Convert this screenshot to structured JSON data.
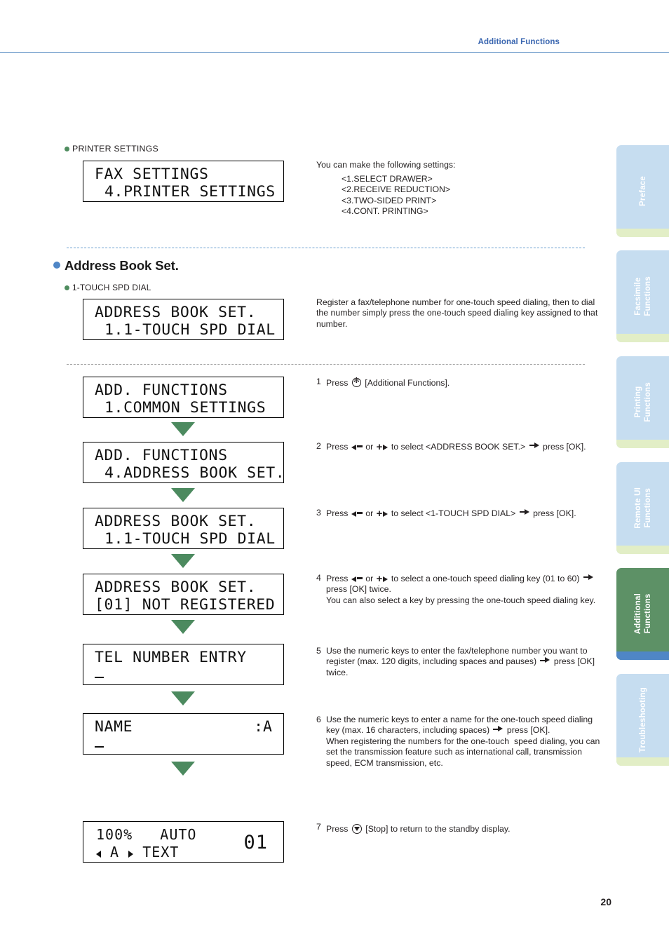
{
  "header": {
    "title": "Additional Functions"
  },
  "page_number": "20",
  "printer_settings": {
    "label": "PRINTER SETTINGS",
    "lcd": {
      "line1": "FAX SETTINGS",
      "line2": "4.PRINTER SETTINGS"
    },
    "intro": "You can make the following settings:",
    "options": [
      "<1.SELECT DRAWER>",
      "<2.RECEIVE REDUCTION>",
      "<3.TWO-SIDED PRINT>",
      "<4.CONT. PRINTING>"
    ]
  },
  "address_book": {
    "heading": "Address Book Set.",
    "sub_label": "1-TOUCH SPD DIAL",
    "lcd": {
      "line1": "ADDRESS BOOK SET.",
      "line2": "1.1-TOUCH SPD DIAL"
    },
    "description": "Register a fax/telephone number for one-touch speed dialing, then to dial the number simply press the one-touch speed dialing key assigned to that number."
  },
  "flow": {
    "screens": [
      {
        "line1": "ADD. FUNCTIONS",
        "line2": "1.COMMON SETTINGS"
      },
      {
        "line1": "ADD. FUNCTIONS",
        "line2": "4.ADDRESS BOOK SET."
      },
      {
        "line1": "ADDRESS BOOK SET.",
        "line2": "1.1-TOUCH SPD DIAL"
      },
      {
        "line1": "ADDRESS BOOK SET.",
        "line2": "[01] NOT REGISTERED"
      },
      {
        "line1": "TEL NUMBER ENTRY",
        "line2": ""
      },
      {
        "line1": "NAME",
        "line2": "",
        "right": ":A"
      }
    ],
    "standby": {
      "zoom": "100%",
      "mode": "AUTO",
      "quality": "TEXT",
      "exposure": "A",
      "count": "01"
    }
  },
  "steps": [
    {
      "num": "1",
      "parts": [
        {
          "t": "text",
          "v": "Press "
        },
        {
          "t": "icon",
          "v": "additional-functions-icon"
        },
        {
          "t": "text",
          "v": " [Additional Functions]."
        }
      ]
    },
    {
      "num": "2",
      "parts": [
        {
          "t": "text",
          "v": "Press "
        },
        {
          "t": "icon",
          "v": "minus-left-key-icon"
        },
        {
          "t": "text",
          "v": " or "
        },
        {
          "t": "icon",
          "v": "plus-right-key-icon"
        },
        {
          "t": "text",
          "v": " to select <ADDRESS BOOK SET.> "
        },
        {
          "t": "icon",
          "v": "arrow-then-icon"
        },
        {
          "t": "text",
          "v": " press [OK]."
        }
      ]
    },
    {
      "num": "3",
      "parts": [
        {
          "t": "text",
          "v": "Press "
        },
        {
          "t": "icon",
          "v": "minus-left-key-icon"
        },
        {
          "t": "text",
          "v": " or "
        },
        {
          "t": "icon",
          "v": "plus-right-key-icon"
        },
        {
          "t": "text",
          "v": " to select <1-TOUCH SPD DIAL> "
        },
        {
          "t": "icon",
          "v": "arrow-then-icon"
        },
        {
          "t": "text",
          "v": " press [OK]."
        }
      ]
    },
    {
      "num": "4",
      "parts": [
        {
          "t": "text",
          "v": "Press "
        },
        {
          "t": "icon",
          "v": "minus-left-key-icon"
        },
        {
          "t": "text",
          "v": " or "
        },
        {
          "t": "icon",
          "v": "plus-right-key-icon"
        },
        {
          "t": "text",
          "v": " to select a one-touch speed dialing key (01 to 60) "
        },
        {
          "t": "icon",
          "v": "arrow-then-icon"
        },
        {
          "t": "text",
          "v": " press [OK] twice."
        },
        {
          "t": "break"
        },
        {
          "t": "text",
          "v": "You can also select a key by pressing the one-touch speed dialing key."
        }
      ]
    },
    {
      "num": "5",
      "parts": [
        {
          "t": "text",
          "v": "Use the numeric keys to enter the fax/telephone number you want to register (max. 120 digits, including spaces and pauses) "
        },
        {
          "t": "icon",
          "v": "arrow-then-icon"
        },
        {
          "t": "text",
          "v": " press [OK] twice."
        }
      ]
    },
    {
      "num": "6",
      "parts": [
        {
          "t": "text",
          "v": "Use the numeric keys to enter a name for the one-touch speed dialing key (max. 16 characters, including spaces) "
        },
        {
          "t": "icon",
          "v": "arrow-then-icon"
        },
        {
          "t": "text",
          "v": " press [OK]."
        },
        {
          "t": "break"
        },
        {
          "t": "text",
          "v": "When registering the numbers for the one-touch  speed dialing, you can set the transmission feature such as international call, transmission speed, ECM transmission, etc."
        }
      ]
    },
    {
      "num": "7",
      "parts": [
        {
          "t": "text",
          "v": "Press "
        },
        {
          "t": "icon",
          "v": "stop-icon"
        },
        {
          "t": "text",
          "v": " [Stop] to return to the standby display."
        }
      ]
    }
  ],
  "tabs": [
    {
      "label": "Preface",
      "active": false
    },
    {
      "label": "Facsimile\nFunctions",
      "active": false
    },
    {
      "label": "Printing\nFunctions",
      "active": false
    },
    {
      "label": "Remote UI\nFunctions",
      "active": false
    },
    {
      "label": "Additional\nFunctions",
      "active": true
    },
    {
      "label": "Troubleshooting",
      "active": false
    }
  ],
  "colors": {
    "header_blue": "#3a66b0",
    "rule_blue": "#5b8fc4",
    "tab_blue": "#c6ddf0",
    "tab_green_strip": "#e2eec6",
    "tab_active_green": "#5d9166",
    "tab_active_strip": "#4f86c6",
    "arrow_green": "#4c8a5f",
    "bullet_green": "#4e8c5e",
    "bullet_blue": "#4f86c6"
  }
}
